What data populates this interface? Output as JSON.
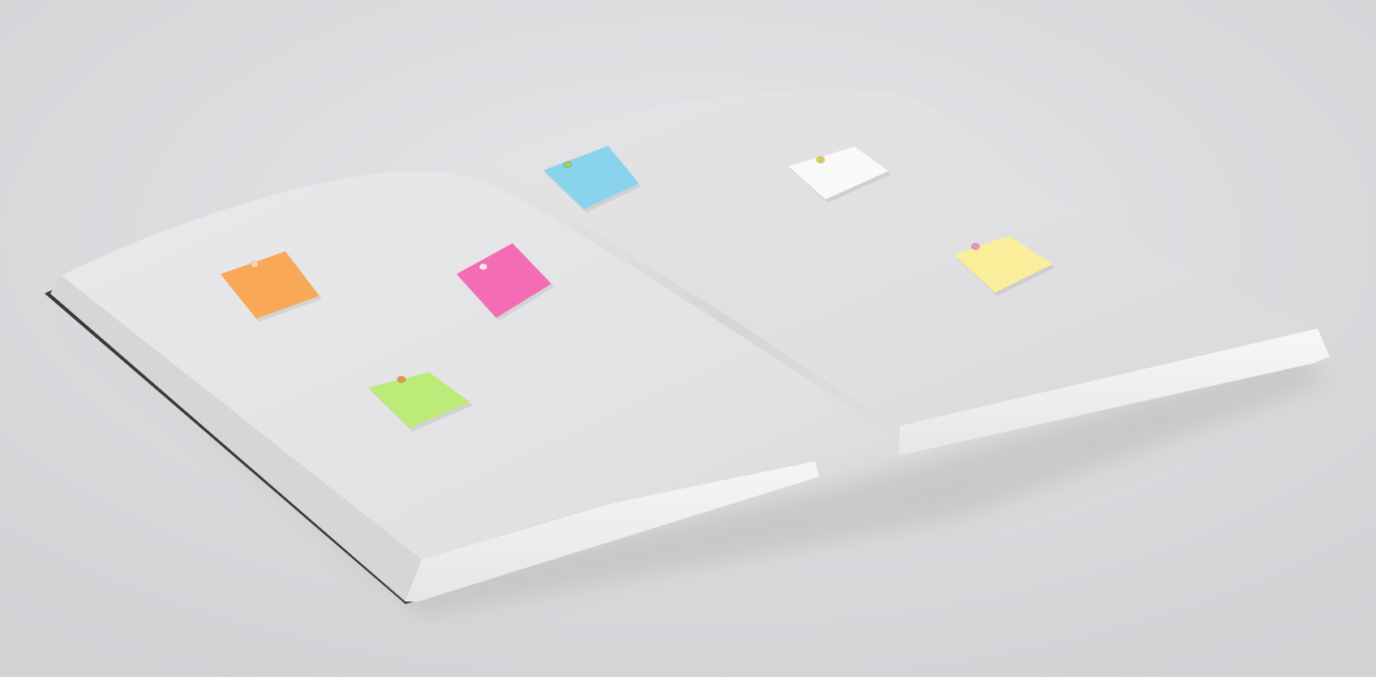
{
  "scene": {
    "subject": "open-notebook",
    "colors": {
      "background_light": "#e4e4e7",
      "background_dark": "#d3d3d6",
      "page_left": "#e3e3e5",
      "page_right": "#e0e0e2",
      "page_edge": "#f4f4f5",
      "cover": "#3a3a3c"
    }
  },
  "notes": [
    {
      "name": "orange-sticky-note",
      "color": "#f9a857",
      "pin": "#f6d7a8"
    },
    {
      "name": "pink-sticky-note",
      "color": "#f46cb4",
      "pin": "#fbe0ec"
    },
    {
      "name": "green-sticky-note",
      "color": "#bdeb79",
      "pin": "#e59a4b"
    },
    {
      "name": "blue-sticky-note",
      "color": "#89d3ec",
      "pin": "#9ccf64"
    },
    {
      "name": "white-sticky-note",
      "color": "#f9f9f9",
      "pin": "#d9cf4a"
    },
    {
      "name": "yellow-sticky-note",
      "color": "#fbee9a",
      "pin": "#e593c3"
    }
  ]
}
